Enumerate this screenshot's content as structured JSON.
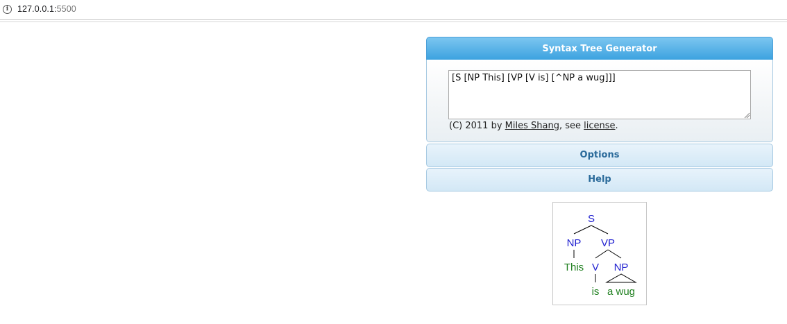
{
  "browser": {
    "url_host": "127.0.0.1:",
    "url_port": "5500"
  },
  "generator": {
    "title": "Syntax Tree Generator",
    "input_value": "[S [NP This] [VP [V is] [^NP a wug]]]",
    "copyright_prefix": "(C) 2011 by ",
    "author_link": "Miles Shang",
    "copyright_mid": ", see ",
    "license_link": "license",
    "copyright_suffix": "."
  },
  "accordion": {
    "options_label": "Options",
    "help_label": "Help"
  },
  "tree": {
    "nodes": {
      "S": "S",
      "NP1": "NP",
      "VP": "VP",
      "V": "V",
      "NP2": "NP"
    },
    "leaves": {
      "this": "This",
      "is": "is",
      "a_wug": "a wug"
    },
    "colors": {
      "nonterminal": "#2020d0",
      "leaf": "#208020"
    }
  }
}
